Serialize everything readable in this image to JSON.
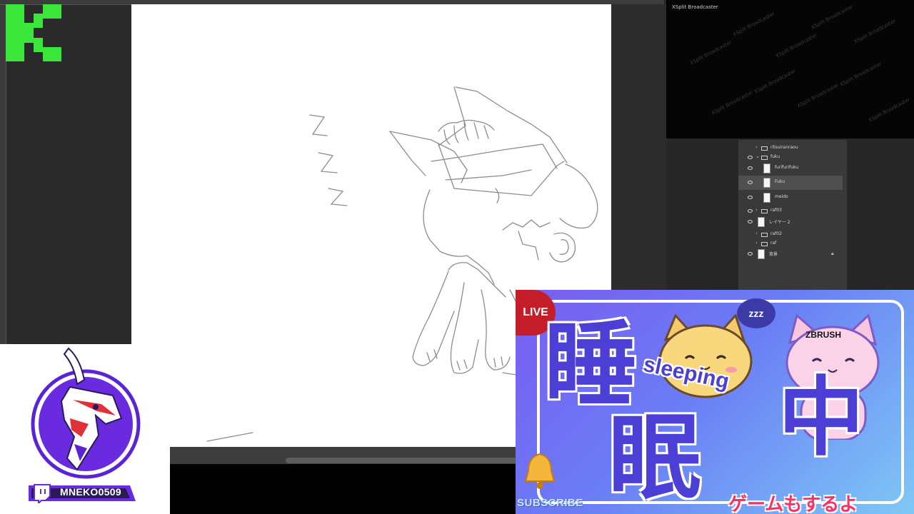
{
  "overlay": {
    "channel_logo_letter": "K",
    "broadcaster": {
      "title": "XSplit Broadcaster",
      "watermark": "XSplit Broadcaster"
    }
  },
  "layers": [
    {
      "name": "ritsuiranraou",
      "kind": "group",
      "visible": false,
      "collapsed": true
    },
    {
      "name": "fuku",
      "kind": "group",
      "visible": true,
      "collapsed": false
    },
    {
      "name": "furifurifuku",
      "kind": "layer",
      "visible": true
    },
    {
      "name": "Fuku",
      "kind": "layer",
      "visible": true,
      "selected": true
    },
    {
      "name": "meido",
      "kind": "layer",
      "visible": true
    },
    {
      "name": "raf03",
      "kind": "group",
      "visible": true,
      "collapsed": true
    },
    {
      "name": "レイヤー 2",
      "kind": "layer",
      "visible": true
    },
    {
      "name": "raf02",
      "kind": "group",
      "visible": false,
      "collapsed": true
    },
    {
      "name": "raf",
      "kind": "group",
      "visible": false,
      "collapsed": true
    },
    {
      "name": "背景",
      "kind": "layer",
      "visible": true,
      "locked": true
    }
  ],
  "sketch": {
    "zzz": "Z Z Z"
  },
  "thumbnail": {
    "live_label": "LIVE",
    "kanji_1": "睡",
    "kanji_2": "眠",
    "kanji_3": "中",
    "sleeping": "sleeping",
    "zzz": "zzz",
    "zbrush": "ZBRUSH",
    "subscribe": "SUBSCRIBE",
    "game_text": "ゲームもするよ"
  },
  "streamer": {
    "handle": "MNEKO0509",
    "platform_icon": "twitch-icon"
  },
  "colors": {
    "logo_green": "#39e639",
    "live_red": "#c41e2a",
    "kanji_blue": "#4b3fd6",
    "dragon_purple": "#6a2be0",
    "game_text_pink": "#ff2e63"
  }
}
